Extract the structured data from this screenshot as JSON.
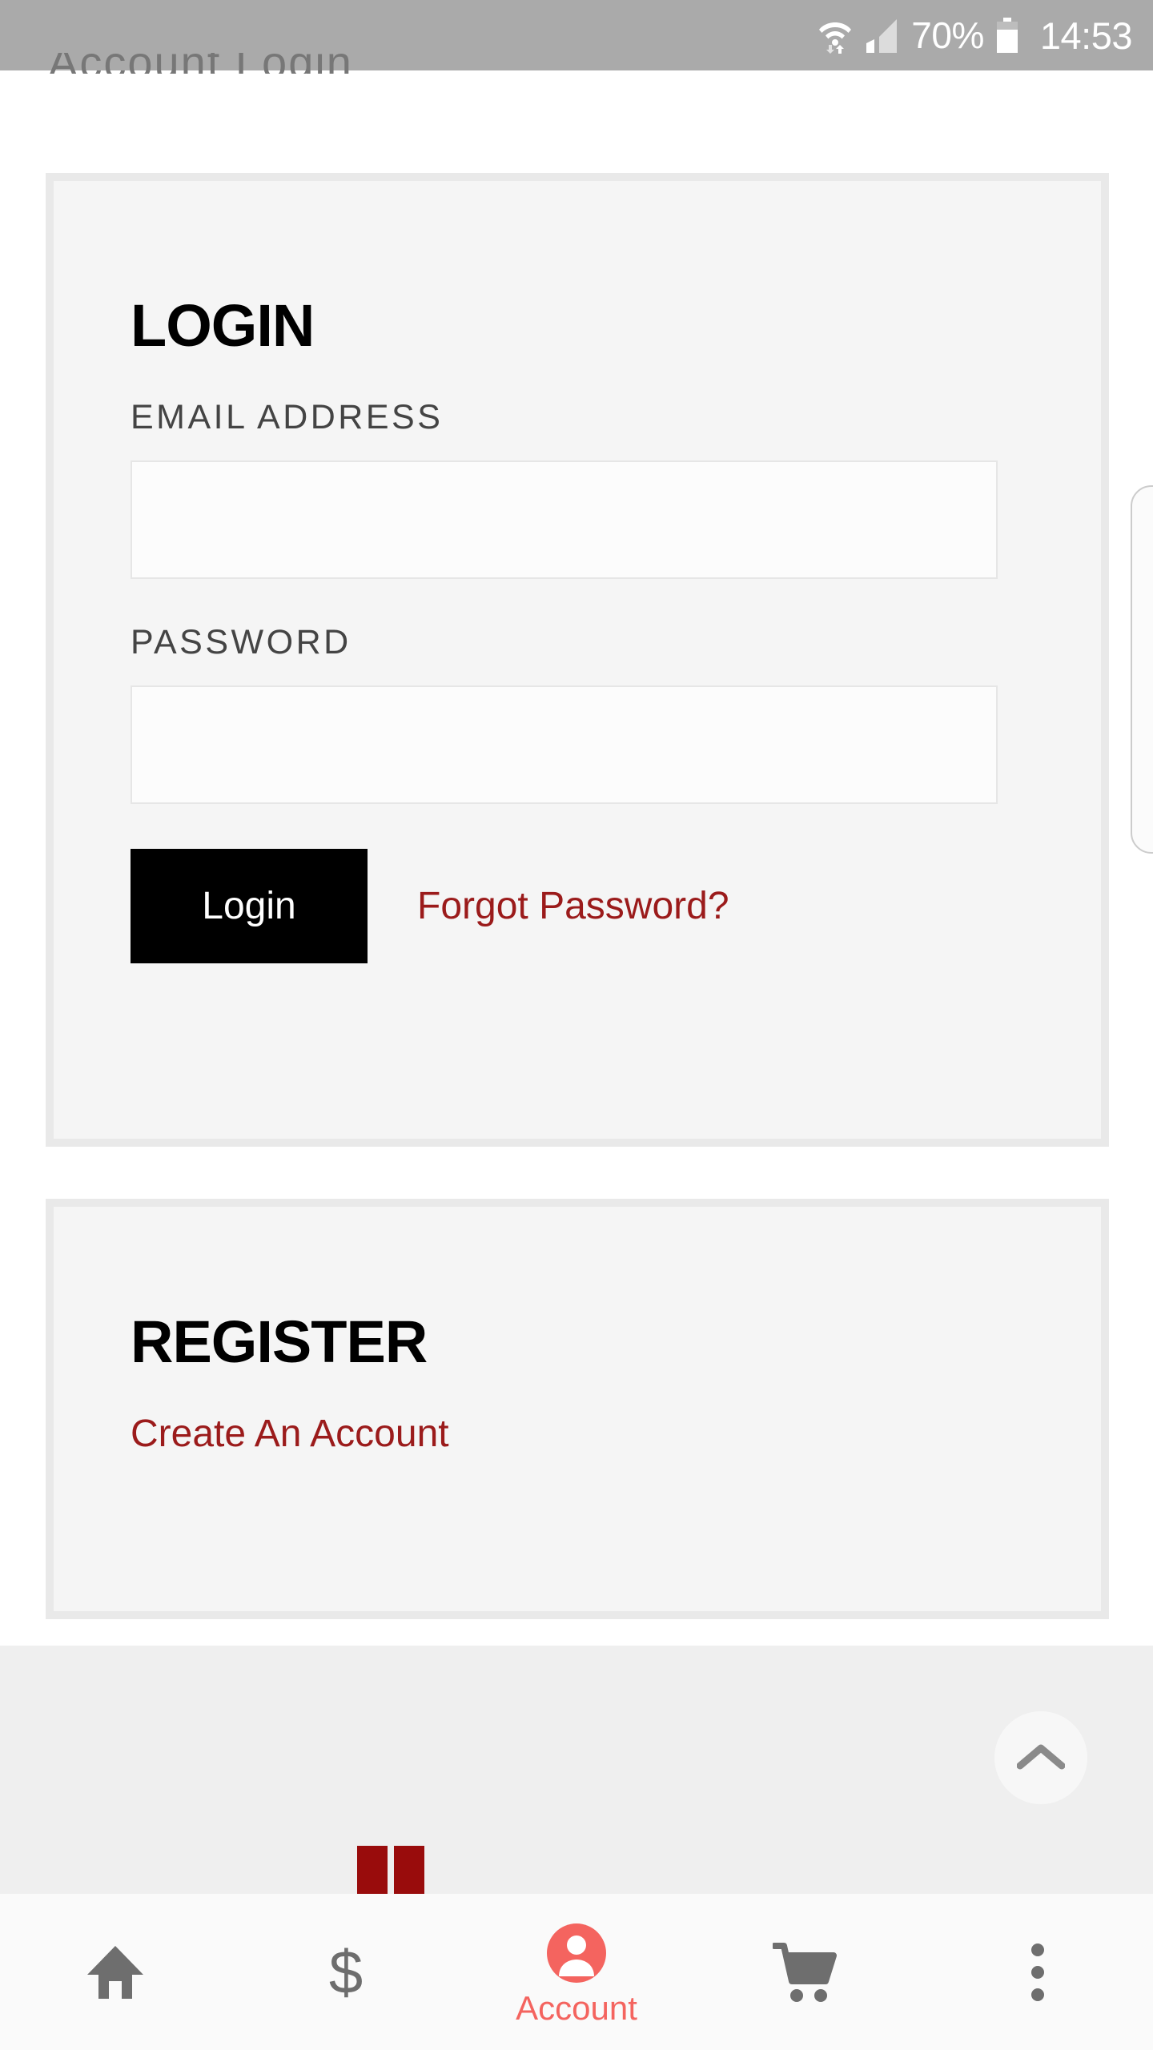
{
  "status_bar": {
    "battery_percent": "70%",
    "time": "14:53",
    "icons": [
      "wifi-icon",
      "cellular-signal-icon",
      "battery-icon"
    ],
    "background_color": "#aaaaaa",
    "text_color": "#ffffff"
  },
  "scrolled_heading_remnant": "Account Login",
  "login_card": {
    "title": "LOGIN",
    "email": {
      "label": "EMAIL ADDRESS",
      "value": "",
      "placeholder": ""
    },
    "password": {
      "label": "PASSWORD",
      "value": "",
      "placeholder": ""
    },
    "submit_label": "Login",
    "forgot_label": "Forgot Password?"
  },
  "register_card": {
    "title": "REGISTER",
    "create_account_label": "Create An Account"
  },
  "scroll_top_button": {
    "icon": "chevron-up-icon"
  },
  "bottom_nav": {
    "items": [
      {
        "icon": "home-icon",
        "label": "",
        "active": false
      },
      {
        "icon": "dollar-sign-icon",
        "label": "",
        "active": false
      },
      {
        "icon": "account-icon",
        "label": "Account",
        "active": true
      },
      {
        "icon": "shopping-cart-icon",
        "label": "",
        "active": false
      },
      {
        "icon": "overflow-menu-icon",
        "label": "",
        "active": false
      }
    ]
  },
  "colors": {
    "accent_red": "#9b1b1b",
    "active_nav_red": "#f4645f",
    "card_background": "#f5f5f5",
    "card_border": "#e9e9e9",
    "page_background": "#ffffff",
    "footer_band": "#efefef",
    "button_black": "#000000",
    "nav_icon_gray": "#6e6e6e",
    "footer_logo_red": "#990c0c"
  }
}
